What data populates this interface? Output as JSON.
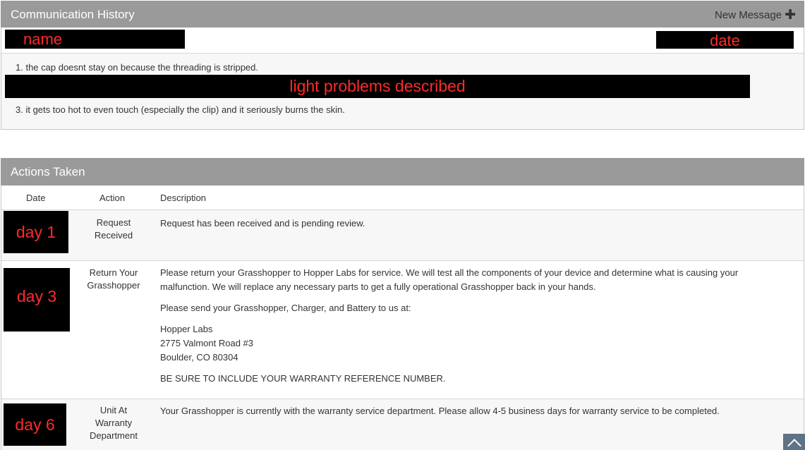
{
  "communication": {
    "title": "Communication History",
    "new_message_label": "New Message",
    "new_message_icon": "plus-icon",
    "redactions": {
      "name": "name",
      "date": "date",
      "problems": "light problems described"
    },
    "lines": [
      "1. the cap doesnt stay on because the threading is stripped.",
      "3. it gets too hot to even touch (especially the clip) and it seriously burns the skin."
    ]
  },
  "actions": {
    "title": "Actions Taken",
    "columns": [
      "Date",
      "Action",
      "Description"
    ],
    "rows": [
      {
        "date_redaction": "day 1",
        "action": [
          "Request",
          "Received"
        ],
        "paragraphs": [
          "Request has been received and is pending review."
        ]
      },
      {
        "date_redaction": "day 3",
        "action": [
          "Return Your",
          "Grasshopper"
        ],
        "paragraphs": [
          "Please return your Grasshopper to Hopper Labs for service. We will test all the components of your device and determine what is causing your malfunction. We will replace any necessary parts to get a fully operational Grasshopper back in your hands.",
          "Please send your Grasshopper, Charger, and Battery to us at:"
        ],
        "address": [
          "Hopper Labs",
          "2775 Valmont Road #3",
          "Boulder, CO 80304"
        ],
        "note": "BE SURE TO INCLUDE YOUR WARRANTY REFERENCE NUMBER."
      },
      {
        "date_redaction": "day 6",
        "action": [
          "Unit At",
          "Warranty",
          "Department"
        ],
        "paragraphs": [
          "Your Grasshopper is currently with the warranty service department. Please allow 4-5 business days for warranty service to be completed."
        ]
      }
    ]
  },
  "colors": {
    "header_bg": "#9a9a9a",
    "redaction_bg": "#000000",
    "redaction_text": "#ff2a2a",
    "scroll_button": "#5f7386"
  },
  "scroll_top_icon": "chevron-up-icon"
}
